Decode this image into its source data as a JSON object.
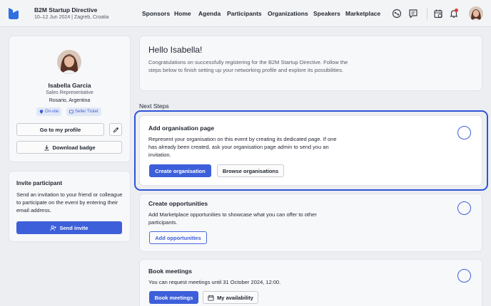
{
  "header": {
    "event_title": "B2M Startup Directive",
    "event_subtitle": "10–12 Jun 2024 | Zagreb, Croatia",
    "nav": [
      "Sponsors",
      "Home",
      "Agenda",
      "Participants",
      "Organizations",
      "Speakers",
      "Marketplace"
    ],
    "icons": [
      "network-icon",
      "chat-icon",
      "calendar-check-icon",
      "bell-icon"
    ]
  },
  "profile": {
    "name": "Isabella Garcia",
    "role": "Sales Representative",
    "location": "Rosario, Argentina",
    "badges": [
      "On-site",
      "Seller Ticket"
    ],
    "go_profile_label": "Go to my profile",
    "download_label": "Download badge"
  },
  "invite": {
    "title": "Invite participant",
    "text": "Send an invitation to your friend or colleague to participate on the event by entering their email address.",
    "button_label": "Send invite"
  },
  "welcome": {
    "title": "Hello Isabella!",
    "text": "Congratulations on successfully registering for the B2M Startup Directive. Follow the steps below to finish setting up your networking profile and explore its possibilities."
  },
  "next_steps_label": "Next Steps",
  "steps": [
    {
      "title": "Add organisation page",
      "text": "Represent your organisation on this event by creating its dedicated page. If one has already been created, ask your organisation page admin to send you an invitation.",
      "primary": "Create organisation",
      "secondary": "Browse organisations"
    },
    {
      "title": "Create opportunities",
      "text": "Add Marketplace opportunities to showcase what you can offer to other participants.",
      "primary": "Add opportunities"
    },
    {
      "title": "Book meetings",
      "text": "You can request meetings until 31 October 2024, 12:00.",
      "primary": "Book meetings",
      "secondary": "My availability"
    }
  ],
  "colors": {
    "accent": "#3d5fd9",
    "highlight": "#2f54d8",
    "notification": "#e53935"
  }
}
